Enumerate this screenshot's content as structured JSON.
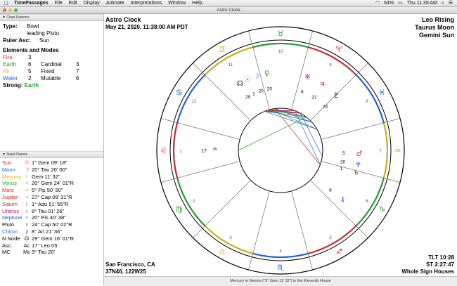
{
  "menubar": {
    "app": "TimePassages",
    "items": [
      "File",
      "Edit",
      "Display",
      "Animate",
      "Interpretations",
      "Window",
      "Help"
    ],
    "battery": "64%",
    "clock": "Thu 11:39 AM"
  },
  "window": {
    "title": "Astro Clock"
  },
  "patterns": {
    "header": "Chart Patterns",
    "type_label": "Type:",
    "type_value": "Bowl",
    "type_sub": "leading Pluto",
    "ruler_label": "Ruler Asc:",
    "ruler_value": "Sun",
    "em_title": "Elements and Modes",
    "elements": [
      {
        "name": "Fire",
        "count": "3",
        "mode": "",
        "mode_count": "",
        "color": "#e02020"
      },
      {
        "name": "Earth",
        "count": "6",
        "mode": "Cardinal",
        "mode_count": "3",
        "color": "#22a022"
      },
      {
        "name": "Air",
        "count": "5",
        "mode": "Fixed",
        "mode_count": "7",
        "color": "#d9b400"
      },
      {
        "name": "Water",
        "count": "2",
        "mode": "Mutable",
        "mode_count": "6",
        "color": "#2060e0"
      }
    ],
    "strong_label": "Strong:",
    "strong_value": "Earth",
    "strong_color": "#22a022"
  },
  "natal": {
    "header": "Natal Planets",
    "planets": [
      {
        "name": "Sun",
        "glyph": "☉",
        "pos": "1° Gem 09' 18\"",
        "color": "#e02020"
      },
      {
        "name": "Moon",
        "glyph": "☽",
        "pos": "20° Tau 20' 00\"",
        "color": "#2060e0"
      },
      {
        "name": "Mercury",
        "glyph": "☿",
        "pos": "Gem 11' 32\"",
        "color": "#d9b400"
      },
      {
        "name": "Venus",
        "glyph": "♀",
        "pos": "20° Gem 24' 01\"R",
        "color": "#22a022"
      },
      {
        "name": "Mars",
        "glyph": "♂",
        "pos": "5° Pis 50' 50\"",
        "color": "#e02020"
      },
      {
        "name": "Jupiter",
        "glyph": "♃",
        "pos": "27° Cap 09' 31\"R",
        "color": "#e02020"
      },
      {
        "name": "Saturn",
        "glyph": "♄",
        "pos": "1° Aqu 51' 55\"R",
        "color": "#8b4513"
      },
      {
        "name": "Uranus",
        "glyph": "♅",
        "pos": "8° Tau 01' 26\"",
        "color": "#d00080"
      },
      {
        "name": "Neptune",
        "glyph": "♆",
        "pos": "20° Pis 40' 38\"",
        "color": "#2060e0"
      },
      {
        "name": "Pluto",
        "glyph": "♇",
        "pos": "24° Cap 50' 02\"R",
        "color": "#000000"
      },
      {
        "name": "Chiron",
        "glyph": "⚷",
        "pos": "8° Ari 21' 36\"",
        "color": "#2060e0"
      },
      {
        "name": "N Node",
        "glyph": "☊",
        "pos": "29° Gem 16' 01\"R",
        "color": "#000000"
      },
      {
        "name": "Asc.",
        "glyph": "Ac",
        "pos": "17° Leo 05'",
        "color": "#000000"
      },
      {
        "name": "MC",
        "glyph": "Mc",
        "pos": "9° Tau 20'",
        "color": "#000000"
      }
    ]
  },
  "chart": {
    "title": "Astro Clock",
    "datetime": "May 21, 2020, 11:38:00 AM PDT",
    "rising": "Leo Rising",
    "moon_sign": "Taurus Moon",
    "sun_sign": "Gemini Sun",
    "location": "San Francisco, CA",
    "coords": "37N46, 122W25",
    "tlt": "TLT 10:28",
    "st": "ST 2:27:47",
    "house_system": "Whole Sign Houses",
    "zodiac": [
      {
        "glyph": "♉",
        "color": "#22a022"
      },
      {
        "glyph": "♈",
        "color": "#e02020"
      },
      {
        "glyph": "♓",
        "color": "#2060e0"
      },
      {
        "glyph": "♒",
        "color": "#d9b400"
      },
      {
        "glyph": "♑",
        "color": "#22a022"
      },
      {
        "glyph": "♐",
        "color": "#e02020"
      },
      {
        "glyph": "♏",
        "color": "#2060e0"
      },
      {
        "glyph": "♎",
        "color": "#d9b400"
      },
      {
        "glyph": "♍",
        "color": "#22a022"
      },
      {
        "glyph": "♌",
        "color": "#e02020"
      },
      {
        "glyph": "♋",
        "color": "#2060e0"
      },
      {
        "glyph": "♊",
        "color": "#d9b400"
      }
    ],
    "house_numbers": [
      "10",
      "9",
      "8",
      "7",
      "6",
      "5",
      "4",
      "3",
      "2",
      "1",
      "12",
      "11"
    ],
    "planet_labels": [
      {
        "glyph": "☽",
        "deg": "20",
        "color": "#2060e0"
      },
      {
        "glyph": "♀",
        "deg": "20",
        "color": "#22a022"
      },
      {
        "glyph": "☉",
        "deg": "1",
        "color": "#e02020"
      },
      {
        "glyph": "☊",
        "deg": "29",
        "color": "#000000"
      },
      {
        "glyph": "♅",
        "deg": "8",
        "color": "#d00080"
      },
      {
        "glyph": "♆",
        "deg": "20",
        "color": "#2060e0"
      },
      {
        "glyph": "♂",
        "deg": "5",
        "color": "#e02020"
      },
      {
        "glyph": "♃",
        "deg": "27",
        "color": "#e02020"
      },
      {
        "glyph": "♇",
        "deg": "24",
        "color": "#000000"
      },
      {
        "glyph": "♄",
        "deg": "1",
        "color": "#8b4513"
      },
      {
        "glyph": "⚷",
        "deg": "8",
        "color": "#2060e0"
      }
    ],
    "asc_label": "17",
    "asc_min": "05"
  },
  "status": {
    "text": "Mercury in Gemini (\"9° Gem 11' 32\") in the Eleventh House"
  }
}
